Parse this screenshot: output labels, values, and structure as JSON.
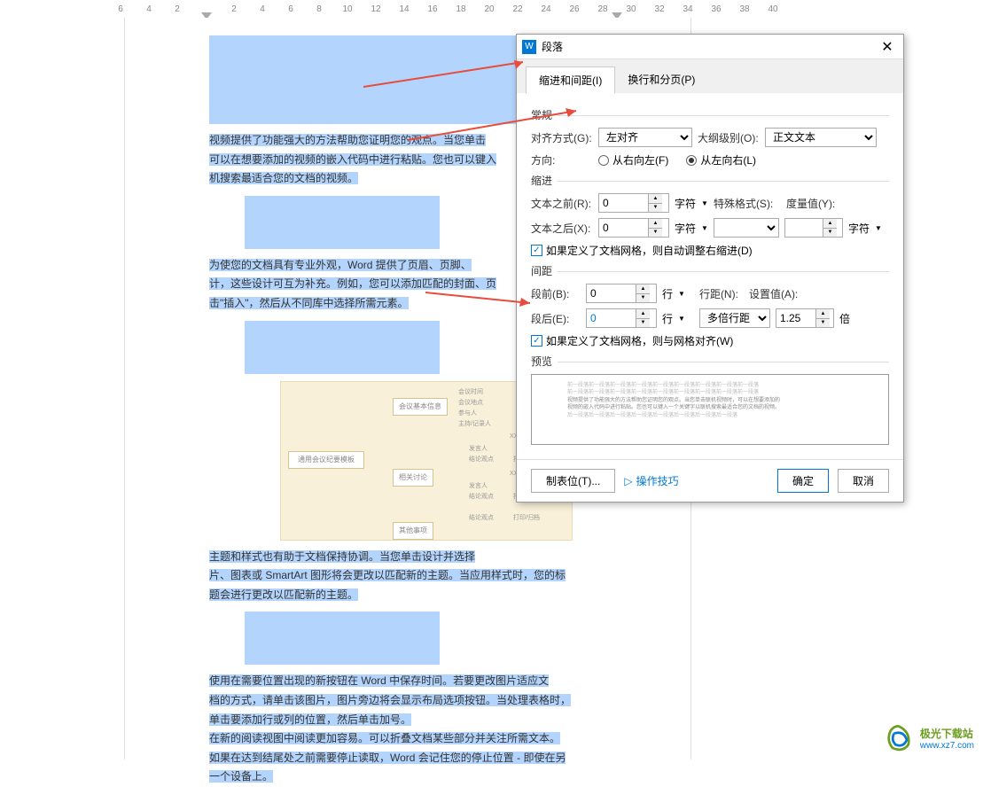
{
  "ruler": [
    "6",
    "4",
    "2",
    "",
    "2",
    "4",
    "6",
    "8",
    "10",
    "12",
    "14",
    "16",
    "18",
    "20",
    "22",
    "24",
    "26",
    "28",
    "30",
    "32",
    "34",
    "36",
    "38",
    "40"
  ],
  "doc": {
    "para1": "视频提供了功能强大的方法帮助您证明您的观点。当您单击",
    "para1b": "可以在想要添加的视频的嵌入代码中进行粘贴。您也可以键入",
    "para1c": "机搜索最适合您的文档的视频。",
    "para2": "为使您的文档具有专业外观，Word 提供了页眉、页脚、",
    "para2b": "计，这些设计可互为补充。例如，您可以添加匹配的封面、页",
    "para2c": "击\"插入\"，然后从不同库中选择所需元素。",
    "para3": "主题和样式也有助于文档保持协调。当您单击设计并选择",
    "para3b": "片、图表或 SmartArt 图形将会更改以匹配新的主题。当应用样式时，您的标",
    "para3c": "题会进行更改以匹配新的主题。",
    "para4": "使用在需要位置出现的新按钮在 Word 中保存时间。若要更改图片适应文",
    "para4b": "档的方式，请单击该图片，图片旁边将会显示布局选项按钮。当处理表格时，",
    "para4c": "单击要添加行或列的位置，然后单击加号。",
    "para5": "在新的阅读视图中阅读更加容易。可以折叠文档某些部分并关注所需文本。",
    "para5b": "如果在达到结尾处之前需要停止读取，Word 会记住您的停止位置 - 即使在另",
    "para5c": "一个设备上。",
    "diagram_main": "通用会议纪要模板",
    "diagram_nodes": [
      "会议基本信息",
      "相关讨论",
      "其他事项"
    ],
    "diagram_leaves": [
      "会议时间",
      "会议地点",
      "参与人",
      "主持/记录人",
      "发言人",
      "结论观点",
      "打印/归档",
      "发言人",
      "结论观点",
      "打印/归档",
      "结论观点",
      "打印/归档"
    ],
    "diagram_xxx": "XXX"
  },
  "dialog": {
    "title": "段落",
    "tabs": [
      "缩进和间距(I)",
      "换行和分页(P)"
    ],
    "section_general": "常规",
    "align_label": "对齐方式(G):",
    "align_value": "左对齐",
    "outline_label": "大纲级别(O):",
    "outline_value": "正文文本",
    "direction_label": "方向:",
    "direction_rtl": "从右向左(F)",
    "direction_ltr": "从左向右(L)",
    "section_indent": "缩进",
    "text_before_label": "文本之前(R):",
    "text_before_value": "0",
    "text_after_label": "文本之后(X):",
    "text_after_value": "0",
    "char_unit": "字符",
    "special_label": "特殊格式(S):",
    "measure_label": "度量值(Y):",
    "checkbox_grid": "如果定义了文档网格，则自动调整右缩进(D)",
    "section_spacing": "间距",
    "before_label": "段前(B):",
    "before_value": "0",
    "after_label": "段后(E):",
    "after_value": "0",
    "line_unit": "行",
    "line_spacing_label": "行距(N):",
    "line_spacing_value": "多倍行距",
    "setting_label": "设置值(A):",
    "setting_value": "1.25",
    "times_unit": "倍",
    "checkbox_snap": "如果定义了文档网格，则与网格对齐(W)",
    "section_preview": "预览",
    "preview_text1": "前一段落前一段落前一段落前一段落前一段落前一段落前一段落前一段落前一段落",
    "preview_text2": "前一段落前一段落前一段落前一段落前一段落前一段落前一段落前一段落前一段落",
    "preview_text3": "视频提供了功能强大的方法帮助您证明您的观点。当您单击联机视频时，可以在想要添加的",
    "preview_text4": "视频的嵌入代码中进行粘贴。您也可以键入一个关键字以联机搜索最适合您的文档的视频。",
    "preview_text5": "后一段落后一段落后一段落后一段落后一段落后一段落后一段落后一段落",
    "btn_tabs": "制表位(T)...",
    "btn_tips": "操作技巧",
    "btn_ok": "确定",
    "btn_cancel": "取消"
  },
  "watermark": {
    "name": "极光下载站",
    "url": "www.xz7.com"
  }
}
